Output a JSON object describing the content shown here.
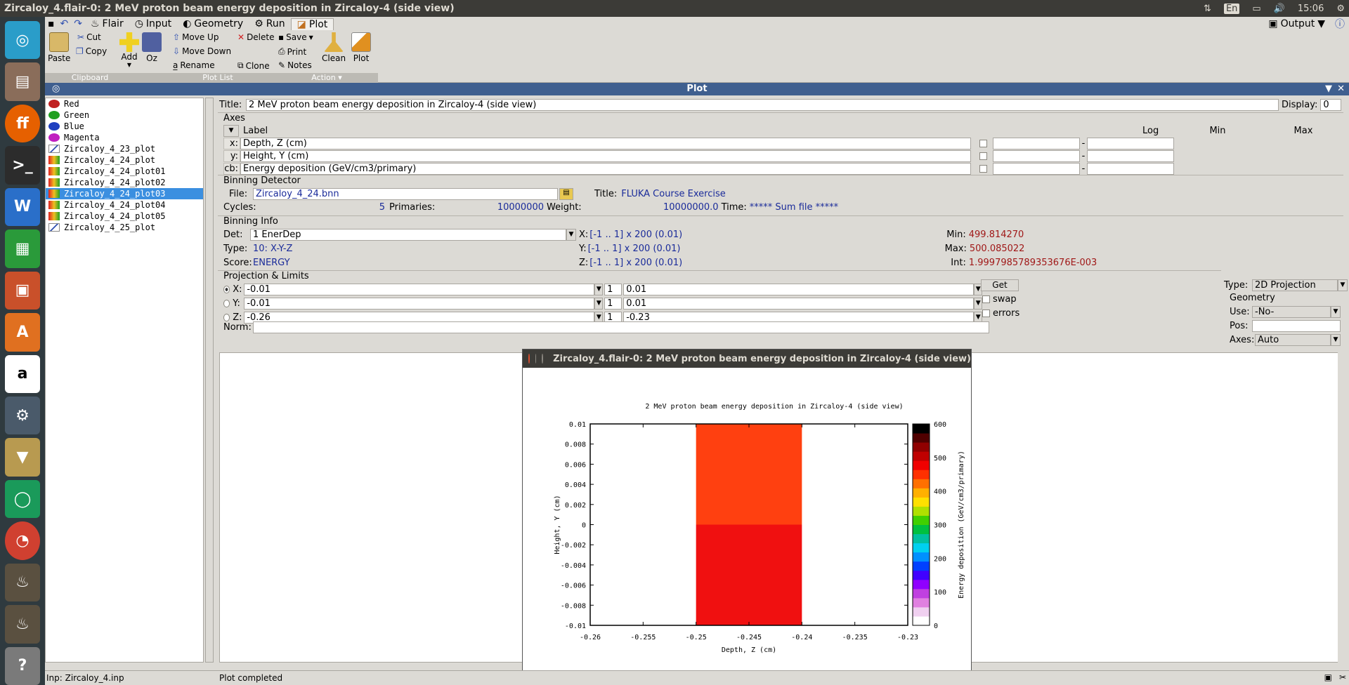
{
  "window": {
    "title": "Zircaloy_4.flair-0: 2 MeV proton beam energy deposition in Zircaloy-4 (side view)",
    "time": "15:06",
    "lang": "En"
  },
  "menu": {
    "items": [
      "Flair",
      "Input",
      "Geometry",
      "Run",
      "Plot"
    ],
    "active": "Plot",
    "output_label": "Output"
  },
  "ribbon": {
    "clipboard": {
      "paste": "Paste",
      "cut": "Cut",
      "copy": "Copy",
      "label": "Clipboard"
    },
    "plotlist": {
      "add": "Add",
      "oz": "Oz",
      "move_up": "Move Up",
      "move_down": "Move Down",
      "rename": "Rename",
      "delete": "Delete",
      "clone": "Clone",
      "label": "Plot List"
    },
    "action": {
      "save": "Save",
      "print": "Print",
      "notes": "Notes",
      "clean": "Clean",
      "plot": "Plot",
      "label": "Action"
    }
  },
  "plot_panel_title": "Plot",
  "tree": {
    "items": [
      "Red",
      "Green",
      "Blue",
      "Magenta",
      "Zircaloy_4_23_plot",
      "Zircaloy_4_24_plot",
      "Zircaloy_4_24_plot01",
      "Zircaloy_4_24_plot02",
      "Zircaloy_4_24_plot03",
      "Zircaloy_4_24_plot04",
      "Zircaloy_4_24_plot05",
      "Zircaloy_4_25_plot"
    ],
    "selected": "Zircaloy_4_24_plot03"
  },
  "form": {
    "title_label": "Title:",
    "title_value": "2 MeV proton beam energy deposition in Zircaloy-4 (side view)",
    "display_label": "Display:",
    "display_value": "0",
    "axes_section": "Axes",
    "axes_header": {
      "label": "Label",
      "log": "Log",
      "min": "Min",
      "max": "Max"
    },
    "axes": [
      {
        "axis": "x:",
        "label": "Depth, Z (cm)"
      },
      {
        "axis": "y:",
        "label": "Height, Y (cm)"
      },
      {
        "axis": "cb:",
        "label": "Energy deposition (GeV/cm3/primary)"
      }
    ],
    "binning_detector": {
      "section": "Binning Detector",
      "file_label": "File:",
      "file_value": "Zircaloy_4_24.bnn",
      "title_label": "Title:",
      "title_value": "FLUKA Course Exercise",
      "cycles_label": "Cycles:",
      "cycles_value": "5",
      "primaries_label": "Primaries:",
      "primaries_value": "10000000",
      "weight_label": "Weight:",
      "weight_value": "10000000.0",
      "time_label": "Time:",
      "time_value": "***** Sum file *****"
    },
    "binning_info": {
      "section": "Binning Info",
      "det_label": "Det:",
      "det_value": "1 EnerDep",
      "type_label": "Type:",
      "type_value": "10: X-Y-Z",
      "score_label": "Score:",
      "score_value": "ENERGY",
      "x_label": "X:",
      "x_value": "[-1 .. 1] x 200 (0.01)",
      "y_label": "Y:",
      "y_value": "[-1 .. 1] x 200 (0.01)",
      "z_label": "Z:",
      "z_value": "[-1 .. 1] x 200 (0.01)",
      "min_label": "Min:",
      "min_value": "499.814270",
      "max_label": "Max:",
      "max_value": "500.085022",
      "int_label": "Int:",
      "int_value": "1.9997985789353676E-003"
    },
    "projection": {
      "section": "Projection & Limits",
      "rows": [
        {
          "axis": "X:",
          "from": "-0.01",
          "step": "1",
          "to": "0.01"
        },
        {
          "axis": "Y:",
          "from": "-0.01",
          "step": "1",
          "to": "0.01"
        },
        {
          "axis": "Z:",
          "from": "-0.26",
          "step": "1",
          "to": "-0.23"
        }
      ],
      "get": "Get",
      "swap": "swap",
      "errors": "errors",
      "norm_label": "Norm:",
      "type_label": "Type:",
      "type_value": "2D Projection",
      "geometry_section": "Geometry",
      "use_label": "Use:",
      "use_value": "-No-",
      "pos_label": "Pos:",
      "axes_label": "Axes:",
      "axes_value": "Auto"
    }
  },
  "plot_window": {
    "title": "Zircaloy_4.flair-0: 2 MeV proton beam energy deposition in Zircaloy-4 (side view)"
  },
  "chart_data": {
    "type": "heatmap",
    "title": "2 MeV proton beam energy deposition in Zircaloy-4 (side view)",
    "xlabel": "Depth, Z (cm)",
    "ylabel": "Height, Y (cm)",
    "cblabel": "Energy deposition (GeV/cm3/primary)",
    "xlim": [
      -0.26,
      -0.23
    ],
    "ylim": [
      -0.01,
      0.01
    ],
    "clim": [
      0,
      600
    ],
    "x_ticks": [
      "-0.26",
      "-0.255",
      "-0.25",
      "-0.245",
      "-0.24",
      "-0.235",
      "-0.23"
    ],
    "y_ticks": [
      "0.01",
      "0.008",
      "0.006",
      "0.004",
      "0.002",
      "0",
      "-0.002",
      "-0.004",
      "-0.006",
      "-0.008",
      "-0.01"
    ],
    "cb_ticks": [
      "600",
      "500",
      "400",
      "300",
      "200",
      "100",
      "0"
    ],
    "cells": [
      {
        "x0": -0.25,
        "x1": -0.24,
        "y0": 0,
        "y1": 0.01,
        "value": 500.085,
        "color": "#ff4010"
      },
      {
        "x0": -0.25,
        "x1": -0.24,
        "y0": -0.01,
        "y1": 0,
        "value": 499.814,
        "color": "#f01010"
      }
    ],
    "colorbar": [
      "#ffffff",
      "#f0d0f0",
      "#e080e0",
      "#c040e0",
      "#9000ff",
      "#4000ff",
      "#0040ff",
      "#0090ff",
      "#00d0f0",
      "#00c0a0",
      "#00c040",
      "#40d000",
      "#b0e000",
      "#ffe000",
      "#ffb000",
      "#ff7000",
      "#ff3000",
      "#f00000",
      "#c00000",
      "#900000",
      "#500000",
      "#000000"
    ],
    "grid": false
  },
  "status": {
    "left": "Inp: Zircaloy_4.inp",
    "right": "Plot completed"
  }
}
